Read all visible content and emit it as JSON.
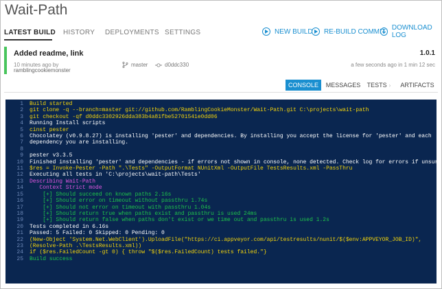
{
  "header": {
    "title": "Wait-Path"
  },
  "tabs": [
    {
      "label": "LATEST BUILD",
      "active": true
    },
    {
      "label": "HISTORY",
      "active": false
    },
    {
      "label": "DEPLOYMENTS",
      "active": false
    },
    {
      "label": "SETTINGS",
      "active": false
    }
  ],
  "actions": [
    {
      "label": "NEW BUILD",
      "icon": "play-icon"
    },
    {
      "label": "RE-BUILD COMMIT",
      "icon": "play-icon"
    },
    {
      "label": "DOWNLOAD LOG",
      "icon": "download-icon"
    }
  ],
  "build": {
    "message": "Added readme, link",
    "time_ago": "10 minutes ago by",
    "author": "ramblingcookiemonster",
    "branch": "master",
    "commit": "d0ddc330",
    "version": "1.0.1",
    "finished": "a few seconds ago in 1 min 12 sec",
    "status_color": "#48c45c"
  },
  "subtabs": [
    {
      "label": "CONSOLE",
      "active": true
    },
    {
      "label": "MESSAGES",
      "active": false
    },
    {
      "label": "TESTS",
      "active": false
    },
    {
      "label": "ARTIFACTS",
      "active": false
    }
  ],
  "console": {
    "lines": [
      {
        "n": "1",
        "text": "Build started",
        "c": "y"
      },
      {
        "n": "2",
        "text": "git clone -q --branch=master git://github.com/RamblingCookieMonster/Wait-Path.git C:\\projects\\wait-path",
        "c": "y"
      },
      {
        "n": "3",
        "text": "git checkout -qf d0ddc3302926dda383b4a81fbe52701541e0dd06",
        "c": "y"
      },
      {
        "n": "4",
        "text": "Running Install scripts",
        "c": "w"
      },
      {
        "n": "5",
        "text": "cinst pester",
        "c": "y"
      },
      {
        "n": "6",
        "text": "Chocolatey (v0.9.8.27) is installing 'pester' and dependencies. By installing you accept the license for 'pester' and each",
        "c": "w"
      },
      {
        "n": "7",
        "text": "dependency you are installing.",
        "c": "w"
      },
      {
        "n": "8",
        "text": "",
        "c": "w"
      },
      {
        "n": "9",
        "text": "pester v3.3.5",
        "c": "w"
      },
      {
        "n": "10",
        "text": "Finished installing 'pester' and dependencies - if errors not shown in console, none detected. Check log for errors if unsure.",
        "c": "w"
      },
      {
        "n": "11",
        "text": "$res = Invoke-Pester -Path \".\\Tests\" -OutputFormat NUnitXml -OutputFile TestsResults.xml -PassThru",
        "c": "y"
      },
      {
        "n": "12",
        "text": "Executing all tests in 'C:\\projects\\wait-path\\Tests'",
        "c": "w"
      },
      {
        "n": "13",
        "text": "Describing Wait-Path",
        "c": "m"
      },
      {
        "n": "14",
        "text": "   Context Strict mode",
        "c": "m"
      },
      {
        "n": "15",
        "text": "    [+] Should succeed on known paths 2.16s",
        "c": "g"
      },
      {
        "n": "16",
        "text": "    [+] Should error on timeout without passthru 1.74s",
        "c": "g"
      },
      {
        "n": "17",
        "text": "    [+] Should not error on timeout with passthru 1.04s",
        "c": "g"
      },
      {
        "n": "18",
        "text": "    [+] Should return true when paths exist and passthru is used 24ms",
        "c": "g"
      },
      {
        "n": "19",
        "text": "    [+] Should return false when paths don't exist or we time out and passthru is used 1.2s",
        "c": "g"
      },
      {
        "n": "20",
        "text": "Tests completed in 6.16s",
        "c": "w"
      },
      {
        "n": "21",
        "text": "Passed: 5 Failed: 0 Skipped: 0 Pending: 0",
        "c": "w"
      },
      {
        "n": "22",
        "text": "(New-Object 'System.Net.WebClient').UploadFile(\"https://ci.appveyor.com/api/testresults/nunit/$($env:APPVEYOR_JOB_ID)\",",
        "c": "y"
      },
      {
        "n": "23",
        "text": "(Resolve-Path .\\TestsResults.xml))",
        "c": "y"
      },
      {
        "n": "24",
        "text": "if ($res.FailedCount -gt 0) { throw \"$($res.FailedCount) tests failed.\"}",
        "c": "y"
      },
      {
        "n": "25",
        "text": "Build success",
        "c": "g"
      }
    ]
  }
}
